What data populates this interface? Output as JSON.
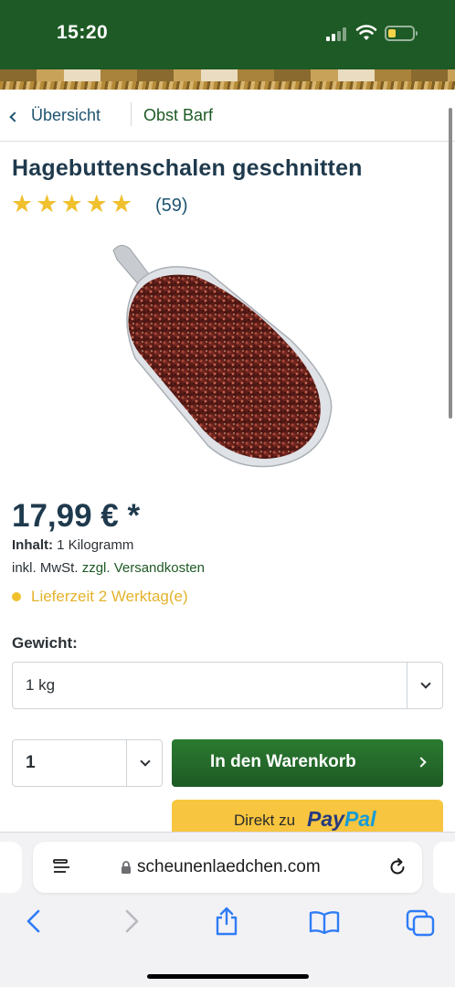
{
  "status": {
    "time": "15:20"
  },
  "breadcrumb": {
    "back_label": "Übersicht",
    "category": "Obst Barf"
  },
  "product": {
    "title": "Hagebuttenschalen geschnitten",
    "rating_stars": 5,
    "review_count": "(59)",
    "price": "17,99 € *",
    "content_label": "Inhalt:",
    "content_value": "1 Kilogramm",
    "tax_prefix": "inkl. MwSt.",
    "shipping_link": "zzgl. Versandkosten",
    "delivery": "Lieferzeit 2 Werktag(e)"
  },
  "variant": {
    "label": "Gewicht:",
    "selected": "1 kg"
  },
  "purchase": {
    "quantity": "1",
    "cart_button": "In den Warenkorb",
    "paypal_prefix": "Direkt zu",
    "paypal_brand_1": "Pay",
    "paypal_brand_2": "Pal"
  },
  "browser": {
    "url": "scheunenlaedchen.com"
  },
  "colors": {
    "brand_green": "#1e5a25",
    "accent_yellow": "#f0c02e",
    "link_blue": "#1f5470"
  }
}
